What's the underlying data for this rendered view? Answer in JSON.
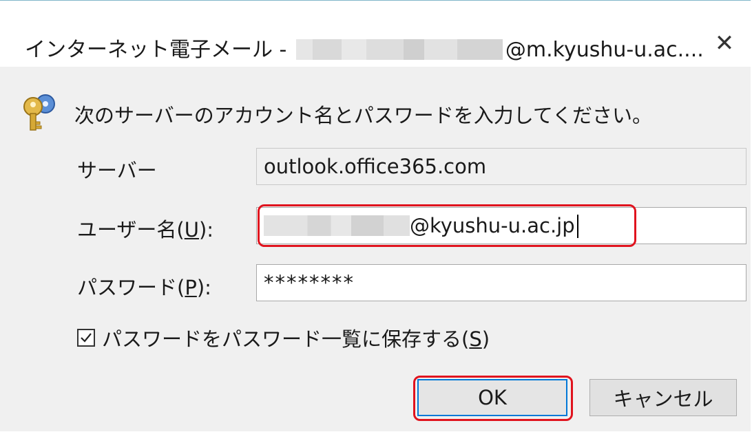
{
  "dialog": {
    "title_prefix": "インターネット電子メール - ",
    "title_suffix": "@m.kyushu-u.ac....",
    "close_glyph": "✕"
  },
  "prompt": "次のサーバーのアカウント名とパスワードを入力してください。",
  "fields": {
    "server": {
      "label": "サーバー",
      "value": "outlook.office365.com"
    },
    "username": {
      "label_pre": "ユーザー名(",
      "accel": "U",
      "label_post": "):",
      "value_suffix": "@kyushu-u.ac.jp"
    },
    "password": {
      "label_pre": "パスワード(",
      "accel": "P",
      "label_post": "):",
      "value": "********"
    }
  },
  "save_password": {
    "checked": true,
    "label_pre": "パスワードをパスワード一覧に保存する(",
    "accel": "S",
    "label_post": ")"
  },
  "buttons": {
    "ok": "OK",
    "cancel": "キャンセル"
  },
  "colors": {
    "highlight": "#e0131e",
    "focus_border": "#0078d7",
    "body_bg": "#f0f0f0"
  },
  "icons": {
    "prompt_icon": "key-icon",
    "close": "close-icon",
    "check": "checkmark-icon"
  }
}
